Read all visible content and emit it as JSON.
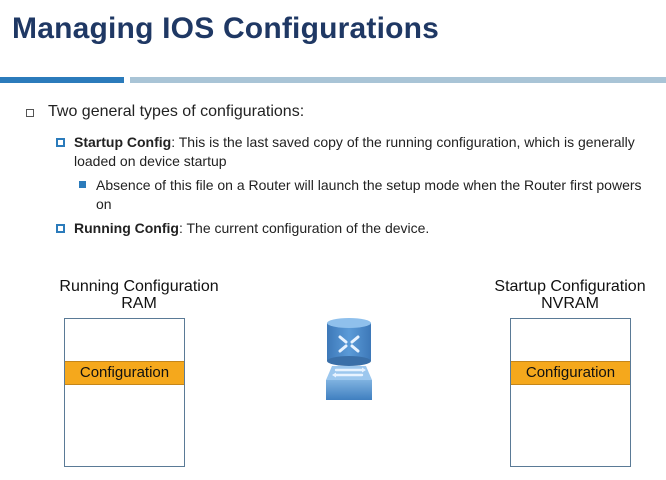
{
  "slide": {
    "title": "Managing IOS Configurations"
  },
  "bullets": {
    "level1": "Two general types of configurations:",
    "startup": {
      "label": "Startup Config",
      "text": ":  This is the last saved copy of the running configuration, which is generally loaded on device startup"
    },
    "startup_sub": "Absence of this file on a Router will launch the setup mode when the Router first powers on",
    "running": {
      "label": "Running Config",
      "text": ":  The current configuration of the device."
    }
  },
  "diagram": {
    "left": {
      "title_line1": "Running  Configuration",
      "title_line2": "RAM",
      "band": "Configuration"
    },
    "right": {
      "title_line1": "Startup Configuration",
      "title_line2": "NVRAM",
      "band": "Configuration"
    },
    "router_icon": "router-icon"
  },
  "colors": {
    "title": "#1f3864",
    "accent_blue": "#2b7bbb",
    "accent_light": "#a9c4d6",
    "band_orange": "#f5a81c"
  }
}
